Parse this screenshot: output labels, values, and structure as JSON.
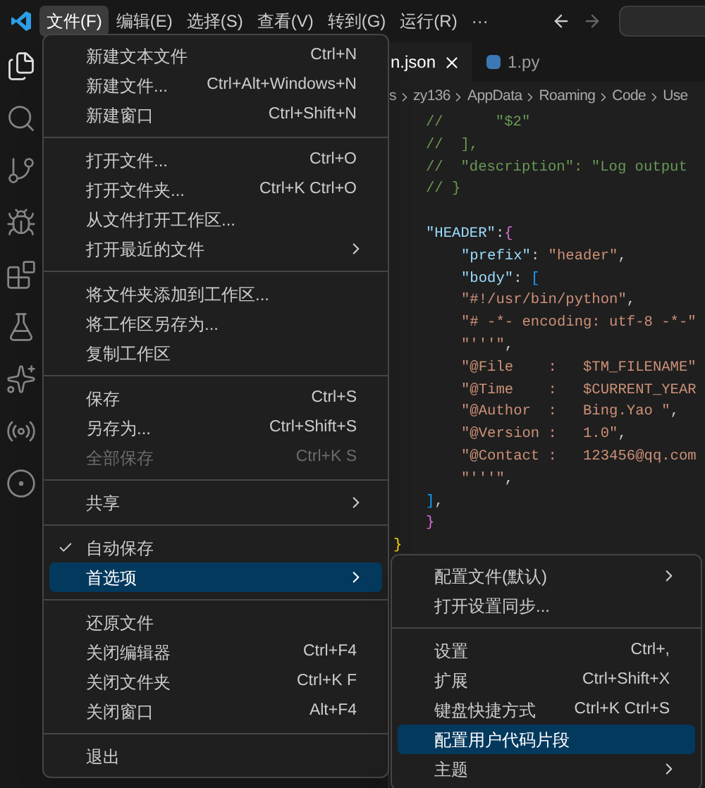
{
  "menu_bar": {
    "items": [
      {
        "label": "文件(F)",
        "selected": true
      },
      {
        "label": "编辑(E)",
        "selected": false
      },
      {
        "label": "选择(S)",
        "selected": false
      },
      {
        "label": "查看(V)",
        "selected": false
      },
      {
        "label": "转到(G)",
        "selected": false
      },
      {
        "label": "运行(R)",
        "selected": false
      },
      {
        "label": "···",
        "selected": false
      }
    ]
  },
  "activity_bar": {
    "items": [
      {
        "kind": "files",
        "selected": true
      },
      {
        "kind": "search",
        "selected": false
      },
      {
        "kind": "git",
        "selected": false
      },
      {
        "kind": "debug",
        "selected": false
      },
      {
        "kind": "extensions",
        "selected": false
      },
      {
        "kind": "flask",
        "selected": false
      },
      {
        "kind": "ai",
        "selected": false
      },
      {
        "kind": "remote",
        "selected": false
      },
      {
        "kind": "target",
        "selected": false
      }
    ]
  },
  "tabs": [
    {
      "label": "n.json",
      "selected": true,
      "closable": true
    },
    {
      "label": "1.py",
      "selected": false,
      "closable": false
    }
  ],
  "breadcrumb": [
    "s",
    "zy136",
    "AppData",
    "Roaming",
    "Code",
    "Use"
  ],
  "code_lines": [
    {
      "kind": "top",
      "tokens": [
        {
          "kind": "comment",
          "text": "//      \"$2\""
        }
      ]
    },
    {
      "kind": "top",
      "tokens": [
        {
          "kind": "comment",
          "text": "//  ],"
        }
      ]
    },
    {
      "kind": "top",
      "tokens": [
        {
          "kind": "comment",
          "text": "//  \"description\": \"Log output"
        }
      ]
    },
    {
      "kind": "top",
      "tokens": [
        {
          "kind": "comment",
          "text": "// }"
        }
      ]
    },
    {
      "kind": "blank"
    },
    {
      "kind": "top",
      "tokens": [
        {
          "kind": "key",
          "text": "\"HEADER\""
        },
        {
          "kind": "punct",
          "text": ":"
        },
        {
          "kind": "brace2",
          "text": "{"
        }
      ]
    },
    {
      "kind": "nested",
      "tokens": [
        {
          "kind": "key",
          "text": "\"prefix\""
        },
        {
          "kind": "punct",
          "text": ": "
        },
        {
          "kind": "string",
          "text": "\"header\""
        },
        {
          "kind": "punct",
          "text": ","
        }
      ]
    },
    {
      "kind": "nested",
      "tokens": [
        {
          "kind": "key",
          "text": "\"body\""
        },
        {
          "kind": "punct",
          "text": ": "
        },
        {
          "kind": "brace3",
          "text": "["
        }
      ]
    },
    {
      "kind": "nested",
      "tokens": [
        {
          "kind": "string",
          "text": "\"#!/usr/bin/python\""
        },
        {
          "kind": "punct",
          "text": ","
        }
      ]
    },
    {
      "kind": "nested",
      "tokens": [
        {
          "kind": "string",
          "text": "\"# -*- encoding: utf-8 -*-\""
        }
      ]
    },
    {
      "kind": "nested",
      "tokens": [
        {
          "kind": "string",
          "text": "\"'''\""
        },
        {
          "kind": "punct",
          "text": ","
        }
      ]
    },
    {
      "kind": "nested",
      "tokens": [
        {
          "kind": "string",
          "text": "\"@File    :   $TM_FILENAME\""
        }
      ]
    },
    {
      "kind": "nested",
      "tokens": [
        {
          "kind": "string",
          "text": "\"@Time    :   $CURRENT_YEAR"
        }
      ]
    },
    {
      "kind": "nested",
      "tokens": [
        {
          "kind": "string",
          "text": "\"@Author  :   Bing.Yao \""
        },
        {
          "kind": "punct",
          "text": ","
        }
      ]
    },
    {
      "kind": "nested",
      "tokens": [
        {
          "kind": "string",
          "text": "\"@Version :   1.0\""
        },
        {
          "kind": "punct",
          "text": ","
        }
      ]
    },
    {
      "kind": "nested",
      "tokens": [
        {
          "kind": "string",
          "text": "\"@Contact :   123456@qq.com"
        }
      ]
    },
    {
      "kind": "nested",
      "tokens": [
        {
          "kind": "string",
          "text": "\"'''\""
        },
        {
          "kind": "punct",
          "text": ","
        }
      ]
    },
    {
      "kind": "top",
      "tokens": [
        {
          "kind": "brace3",
          "text": "]"
        },
        {
          "kind": "punct",
          "text": ","
        }
      ]
    },
    {
      "kind": "top",
      "tokens": [
        {
          "kind": "brace2",
          "text": "}"
        }
      ]
    },
    {
      "kind": "outer",
      "tokens": [
        {
          "kind": "brace1",
          "text": "}"
        }
      ]
    }
  ],
  "file_menu": {
    "sections": [
      [
        {
          "label": "新建文本文件",
          "shortcut": "Ctrl+N",
          "submenu": false,
          "checked": false,
          "disabled": false,
          "selected": false
        },
        {
          "label": "新建文件...",
          "shortcut": "Ctrl+Alt+Windows+N",
          "submenu": false,
          "checked": false,
          "disabled": false,
          "selected": false
        },
        {
          "label": "新建窗口",
          "shortcut": "Ctrl+Shift+N",
          "submenu": false,
          "checked": false,
          "disabled": false,
          "selected": false
        }
      ],
      [
        {
          "label": "打开文件...",
          "shortcut": "Ctrl+O",
          "submenu": false,
          "checked": false,
          "disabled": false,
          "selected": false
        },
        {
          "label": "打开文件夹...",
          "shortcut": "Ctrl+K Ctrl+O",
          "submenu": false,
          "checked": false,
          "disabled": false,
          "selected": false
        },
        {
          "label": "从文件打开工作区...",
          "submenu": false,
          "checked": false,
          "disabled": false,
          "selected": false
        },
        {
          "label": "打开最近的文件",
          "submenu": true,
          "checked": false,
          "disabled": false,
          "selected": false
        }
      ],
      [
        {
          "label": "将文件夹添加到工作区...",
          "submenu": false,
          "checked": false,
          "disabled": false,
          "selected": false
        },
        {
          "label": "将工作区另存为...",
          "submenu": false,
          "checked": false,
          "disabled": false,
          "selected": false
        },
        {
          "label": "复制工作区",
          "submenu": false,
          "checked": false,
          "disabled": false,
          "selected": false
        }
      ],
      [
        {
          "label": "保存",
          "shortcut": "Ctrl+S",
          "submenu": false,
          "checked": false,
          "disabled": false,
          "selected": false
        },
        {
          "label": "另存为...",
          "shortcut": "Ctrl+Shift+S",
          "submenu": false,
          "checked": false,
          "disabled": false,
          "selected": false
        },
        {
          "label": "全部保存",
          "shortcut": "Ctrl+K S",
          "submenu": false,
          "checked": false,
          "disabled": true,
          "selected": false
        }
      ],
      [
        {
          "label": "共享",
          "submenu": true,
          "checked": false,
          "disabled": false,
          "selected": false
        }
      ],
      [
        {
          "label": "自动保存",
          "submenu": false,
          "checked": true,
          "disabled": false,
          "selected": false
        },
        {
          "label": "首选项",
          "submenu": true,
          "checked": false,
          "disabled": false,
          "selected": true
        }
      ],
      [
        {
          "label": "还原文件",
          "submenu": false,
          "checked": false,
          "disabled": false,
          "selected": false
        },
        {
          "label": "关闭编辑器",
          "shortcut": "Ctrl+F4",
          "submenu": false,
          "checked": false,
          "disabled": false,
          "selected": false
        },
        {
          "label": "关闭文件夹",
          "shortcut": "Ctrl+K F",
          "submenu": false,
          "checked": false,
          "disabled": false,
          "selected": false
        },
        {
          "label": "关闭窗口",
          "shortcut": "Alt+F4",
          "submenu": false,
          "checked": false,
          "disabled": false,
          "selected": false
        }
      ],
      [
        {
          "label": "退出",
          "submenu": false,
          "checked": false,
          "disabled": false,
          "selected": false
        }
      ]
    ]
  },
  "preferences_menu": {
    "sections": [
      [
        {
          "label": "配置文件(默认)",
          "submenu": true,
          "selected": false
        },
        {
          "label": "打开设置同步...",
          "submenu": false,
          "selected": false
        }
      ],
      [
        {
          "label": "设置",
          "shortcut": "Ctrl+,",
          "submenu": false,
          "selected": false
        },
        {
          "label": "扩展",
          "shortcut": "Ctrl+Shift+X",
          "submenu": false,
          "selected": false
        },
        {
          "label": "键盘快捷方式",
          "shortcut": "Ctrl+K Ctrl+S",
          "submenu": false,
          "selected": false
        },
        {
          "label": "配置用户代码片段",
          "submenu": false,
          "selected": true
        },
        {
          "label": "主题",
          "submenu": true,
          "selected": false
        }
      ]
    ]
  }
}
